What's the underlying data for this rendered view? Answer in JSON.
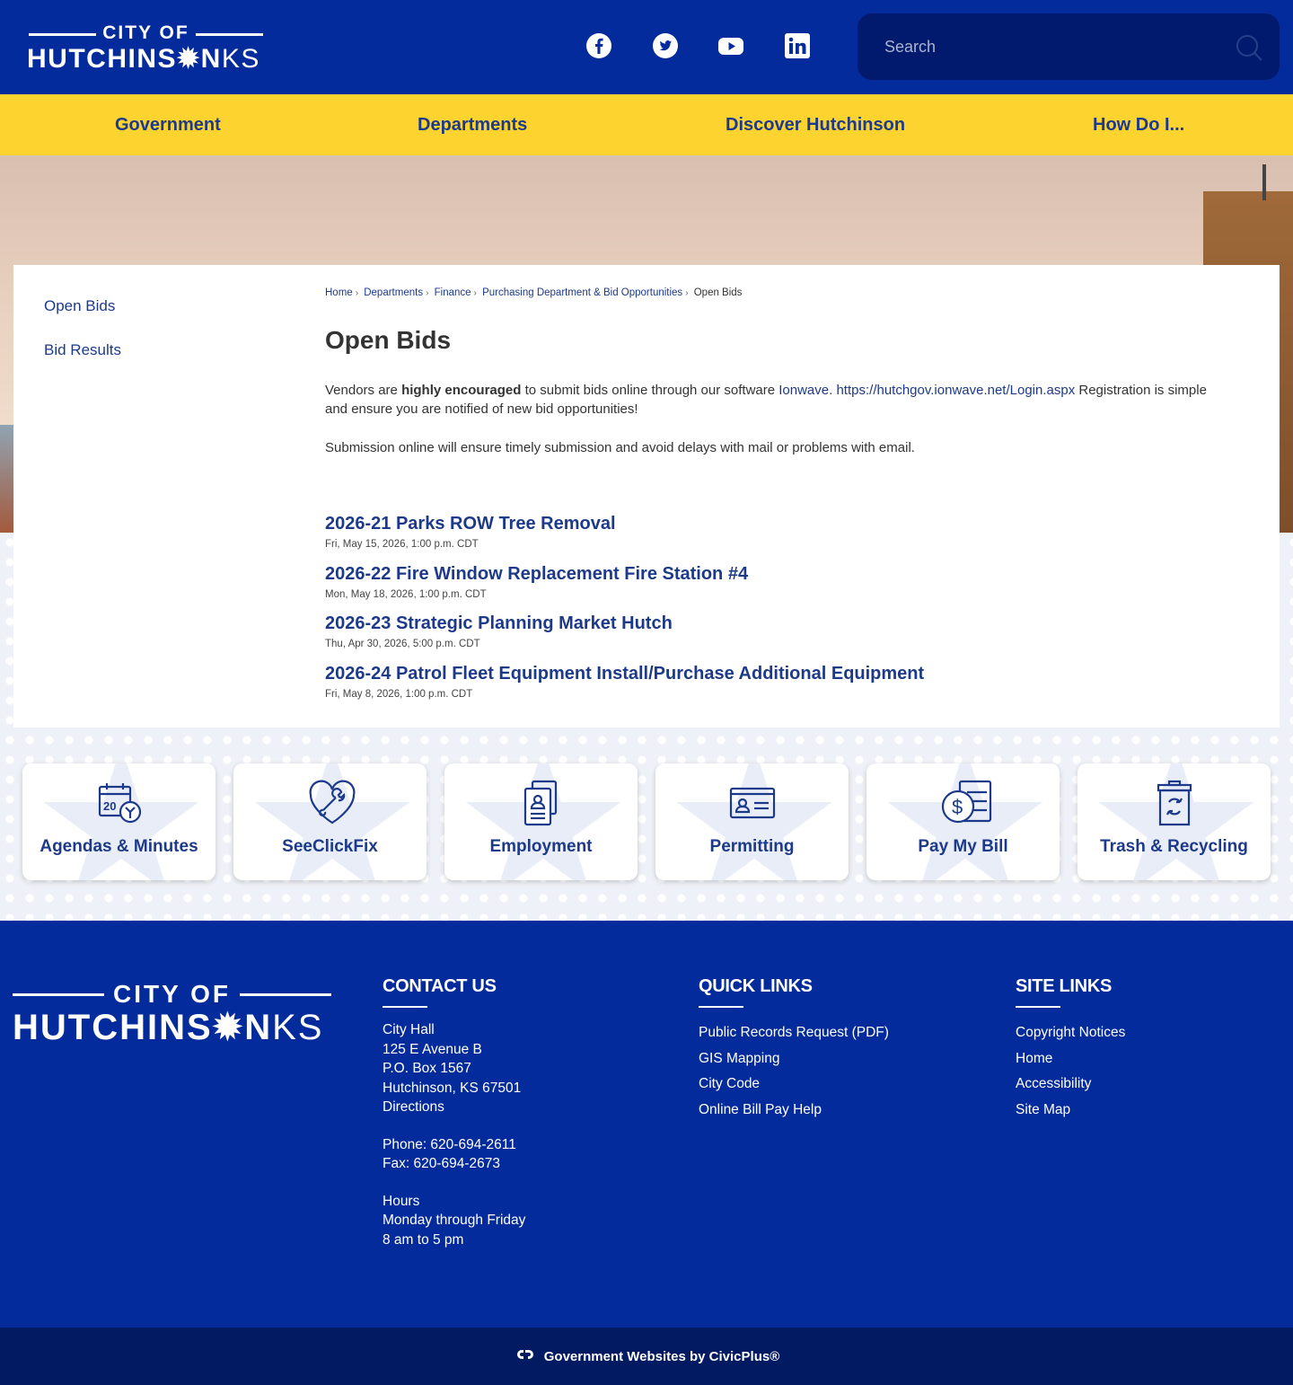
{
  "header": {
    "logo": {
      "line1": "CITY OF",
      "line2": "HUTCHINS",
      "line2_star": "✹",
      "line2_end": "N",
      "line2_suffix": "KS"
    },
    "social": [
      "facebook-icon",
      "twitter-icon",
      "youtube-icon",
      "linkedin-icon"
    ],
    "search": {
      "placeholder": "Search"
    }
  },
  "nav": {
    "items": [
      "Government",
      "Departments",
      "Discover Hutchinson",
      "How Do I..."
    ]
  },
  "sidebar": {
    "items": [
      "Open Bids",
      "Bid Results"
    ]
  },
  "breadcrumb": [
    "Home",
    "Departments",
    "Finance",
    "Purchasing Department & Bid Opportunities",
    "Open Bids"
  ],
  "page": {
    "title": "Open Bids",
    "intro": {
      "pre": "Vendors are ",
      "bold": "highly encouraged",
      "mid": " to submit bids online through our software ",
      "link1": "Ionwave",
      "dot": ". ",
      "link2": "https://hutchgov.ionwave.net/Login.aspx",
      "post": " Registration is simple and ensure you are notified of new bid opportunities!"
    },
    "note": "Submission online will ensure timely submission and avoid delays with mail or problems with email."
  },
  "bids": [
    {
      "title": "2026-21 Parks ROW Tree Removal",
      "date": "Fri, May 15, 2026, 1:00 p.m. CDT"
    },
    {
      "title": "2026-22 Fire Window Replacement Fire Station #4",
      "date": "Mon, May 18, 2026, 1:00 p.m. CDT"
    },
    {
      "title": "2026-23 Strategic Planning Market Hutch",
      "date": "Thu, Apr 30, 2026, 5:00 p.m. CDT"
    },
    {
      "title": "2026-24 Patrol Fleet Equipment Install/Purchase Additional Equipment",
      "date": "Fri, May 8, 2026, 1:00 p.m. CDT"
    }
  ],
  "tiles": [
    {
      "label": "Agendas & Minutes",
      "icon": "calendar-icon"
    },
    {
      "label": "SeeClickFix",
      "icon": "heart-wrench-icon"
    },
    {
      "label": "Employment",
      "icon": "document-person-icon"
    },
    {
      "label": "Permitting",
      "icon": "id-card-icon"
    },
    {
      "label": "Pay My Bill",
      "icon": "dollar-bill-icon"
    },
    {
      "label": "Trash & Recycling",
      "icon": "recycle-bin-icon"
    }
  ],
  "footer": {
    "logo": {
      "line1": "CITY OF",
      "line2": "HUTCHINS",
      "line2_star": "✹",
      "line2_end": "N",
      "line2_suffix": "KS"
    },
    "contact": {
      "heading": "CONTACT US",
      "address": [
        "City Hall",
        "125 E Avenue B",
        "P.O. Box 1567",
        "Hutchinson, KS 67501",
        "Directions"
      ],
      "phone": "Phone: 620-694-2611",
      "fax": "Fax: 620-694-2673",
      "hours": [
        "Hours",
        "Monday through Friday",
        "8 am to 5 pm"
      ]
    },
    "quick_links": {
      "heading": "QUICK LINKS",
      "items": [
        "Public Records Request (PDF)",
        "GIS Mapping",
        "City Code",
        "Online Bill Pay Help"
      ]
    },
    "site_links": {
      "heading": "SITE LINKS",
      "items": [
        "Copyright Notices",
        "Home",
        "Accessibility",
        "Site Map"
      ]
    }
  },
  "bottom": {
    "text": "Government Websites by CivicPlus®"
  },
  "colors": {
    "primary": "#042b9b",
    "accent": "#fdd330",
    "link": "#1d3a8a"
  }
}
